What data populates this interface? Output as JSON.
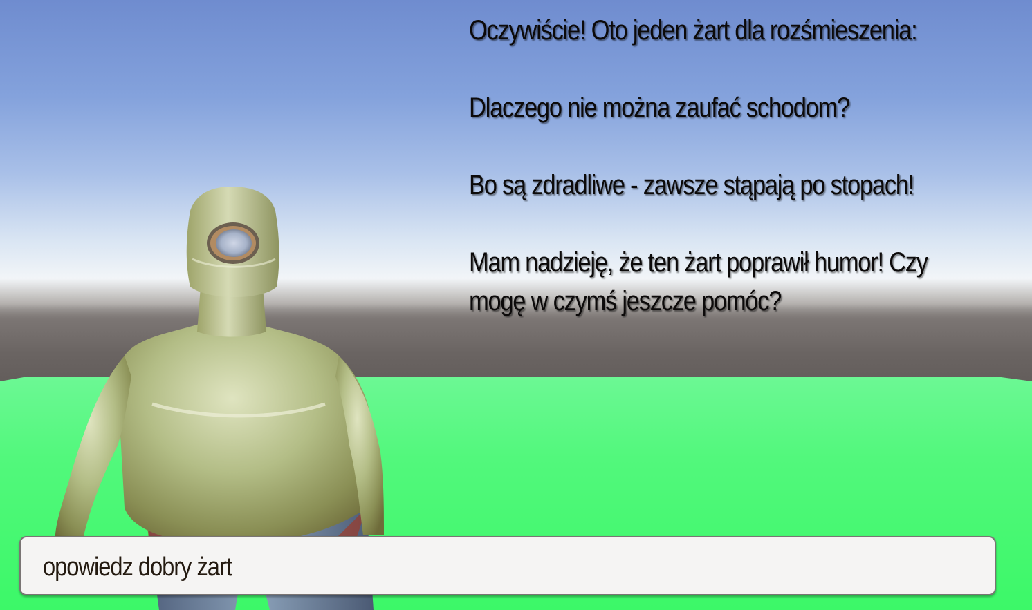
{
  "scene": {
    "colors": {
      "sky_top": "#6f8ccf",
      "horizon": "#f2f5f8",
      "ground_far": "#625c5a",
      "floor": "#3cf868",
      "character_body": "#b8c38f"
    }
  },
  "dialogue": {
    "line1": "Oczywiście! Oto jeden żart dla rozśmieszenia:",
    "line2": "Dlaczego nie można zaufać schodom?",
    "line3": "Bo są zdradliwe - zawsze stąpają po stopach!",
    "line4": "Mam nadzieję, że ten żart poprawił humor! Czy mogę w czymś jeszcze pomóc?"
  },
  "input": {
    "value": "opowiedz dobry żart"
  }
}
